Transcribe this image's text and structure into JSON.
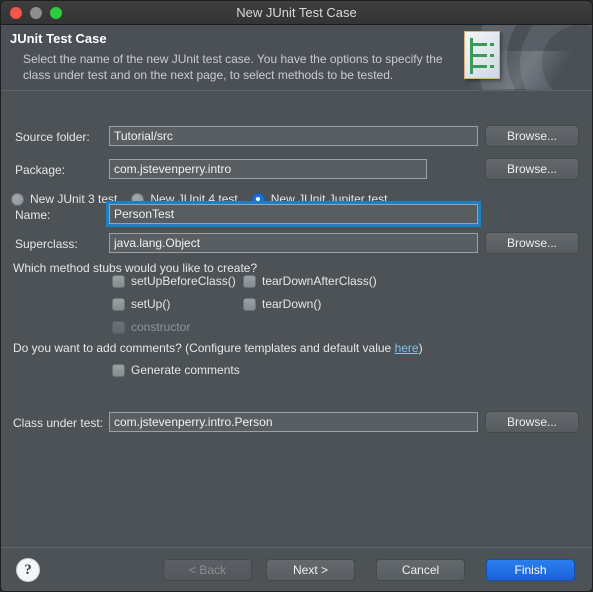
{
  "window": {
    "title": "New JUnit Test Case",
    "traffic_lights": [
      "close",
      "minimize",
      "maximize"
    ]
  },
  "header": {
    "title": "JUnit Test Case",
    "description": "Select the name of the new JUnit test case. You have the options to specify the class under test and on the next page, to select methods to be tested.",
    "icon": "junit-document-icon"
  },
  "test_kind": {
    "options": [
      {
        "label": "New JUnit 3 test",
        "selected": false
      },
      {
        "label": "New JUnit 4 test",
        "selected": false
      },
      {
        "label": "New JUnit Jupiter test",
        "selected": true
      }
    ]
  },
  "fields": {
    "source_folder": {
      "label": "Source folder:",
      "value": "Tutorial/src",
      "placeholder": "",
      "browse_label": "Browse...",
      "focused": false
    },
    "package": {
      "label": "Package:",
      "value": "com.jstevenperry.intro",
      "placeholder": "",
      "browse_label": "Browse...",
      "focused": false
    },
    "name": {
      "label": "Name:",
      "value": "PersonTest",
      "placeholder": "",
      "focused": true
    },
    "superclass": {
      "label": "Superclass:",
      "value": "java.lang.Object",
      "placeholder": "",
      "browse_label": "Browse...",
      "focused": false
    },
    "class_under_test": {
      "label": "Class under test:",
      "value": "com.jstevenperry.intro.Person",
      "placeholder": "",
      "browse_label": "Browse...",
      "focused": false
    }
  },
  "stubs": {
    "prompt": "Which method stubs would you like to create?",
    "items": [
      {
        "label": "setUpBeforeClass()",
        "checked": false,
        "disabled": false
      },
      {
        "label": "tearDownAfterClass()",
        "checked": false,
        "disabled": false
      },
      {
        "label": "setUp()",
        "checked": false,
        "disabled": false
      },
      {
        "label": "tearDown()",
        "checked": false,
        "disabled": false
      },
      {
        "label": "constructor",
        "checked": false,
        "disabled": true
      }
    ]
  },
  "comments": {
    "prompt_prefix": "Do you want to add comments? (Configure templates and default value ",
    "link_label": "here",
    "prompt_suffix": ")",
    "generate_label": "Generate comments",
    "generate_checked": false
  },
  "footer": {
    "help_label": "?",
    "buttons": [
      {
        "label": "< Back",
        "disabled": true,
        "primary": false
      },
      {
        "label": "Next >",
        "disabled": false,
        "primary": false
      },
      {
        "label": "Cancel",
        "disabled": false,
        "primary": false
      },
      {
        "label": "Finish",
        "disabled": false,
        "primary": true
      }
    ]
  },
  "colors": {
    "accent_blue": "#1a6fe0",
    "focus_ring": "#1e7fc2",
    "link_blue": "#7fc4ef",
    "panel": "#4c5256",
    "titlebar": "#3a3a3a",
    "junit_green": "#3a9a57"
  }
}
